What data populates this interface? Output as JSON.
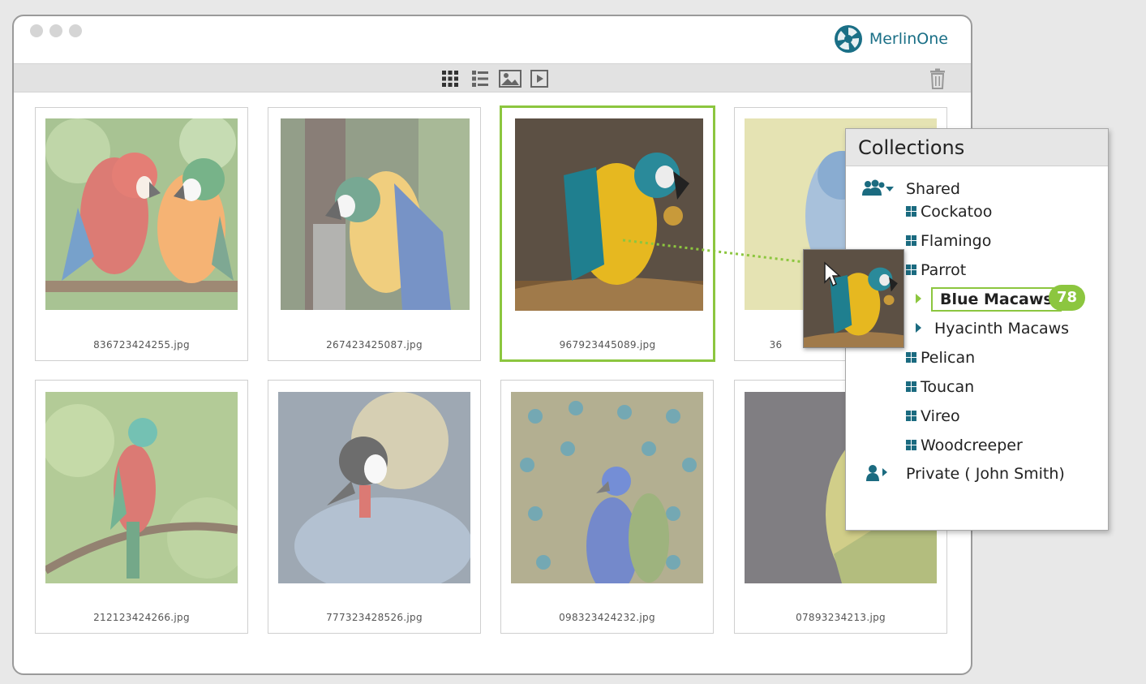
{
  "app": {
    "brand_name": "MerlinOne",
    "accent_color": "#8cc63f",
    "brand_color": "#1a6f86"
  },
  "toolbar": {
    "view_icons": [
      "grid-view-icon",
      "list-view-icon",
      "image-view-icon",
      "video-view-icon"
    ],
    "trash_icon": "trash-icon"
  },
  "assets": [
    {
      "filename": "836723424255.jpg",
      "subject": "scarlet-macaw-pair"
    },
    {
      "filename": "267423425087.jpg",
      "subject": "blue-gold-macaw"
    },
    {
      "filename": "967923445089.jpg",
      "subject": "blue-gold-macaw-eating",
      "selected": true
    },
    {
      "filename": "36",
      "subject": "kingfisher"
    },
    {
      "filename": "212123424266.jpg",
      "subject": "quetzal"
    },
    {
      "filename": "777323428526.jpg",
      "subject": "crowned-crane"
    },
    {
      "filename": "098323424232.jpg",
      "subject": "peacock"
    },
    {
      "filename": "07893234213.jpg",
      "subject": "green-parrot"
    }
  ],
  "collections": {
    "title": "Collections",
    "shared_label": "Shared",
    "items": [
      "Cockatoo",
      "Flamingo",
      "Parrot",
      "Pelican",
      "Toucan",
      "Vireo",
      "Woodcreeper"
    ],
    "parrot_children": [
      "Blue Macaws",
      "Hyacinth Macaws"
    ],
    "drop_target_count": "78",
    "private_label": "Private ( John Smith)"
  }
}
